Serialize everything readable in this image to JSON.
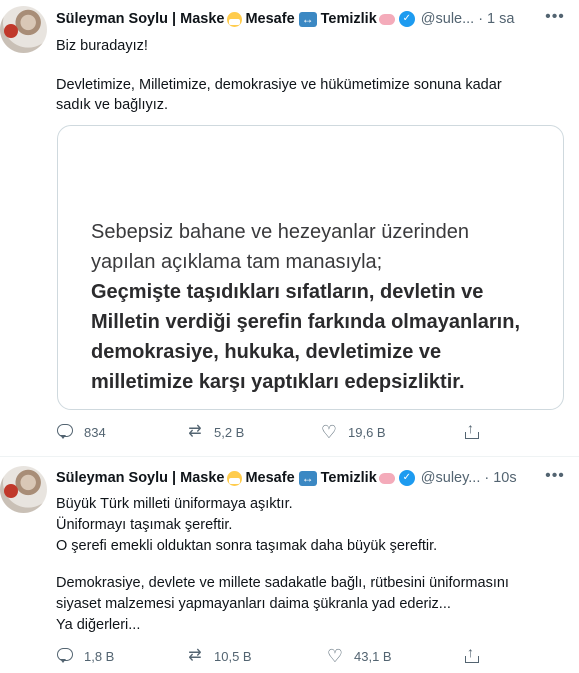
{
  "tweets": [
    {
      "name": "Süleyman Soylu | Maske",
      "mid1": "Mesafe",
      "mid2": "Temizlik",
      "handle": "@sule...",
      "time": "1 sa",
      "text1": "Biz buradayız!",
      "text2": "Devletimize, Milletimize, demokrasiye ve hükümetimize sonuna kadar sadık ve bağlıyız.",
      "card": {
        "line1": "Sebepsiz bahane ve hezeyanlar üzerinden",
        "line2": "yapılan açıklama tam manasıyla;",
        "bold1": "Geçmişte taşıdıkları sıfatların, devletin ve",
        "bold2": "Milletin verdiği şerefin farkında olmayanların,",
        "bold3": "demokrasiye, hukuka, devletimize ve",
        "bold4": "milletimize karşı yaptıkları edepsizliktir."
      },
      "replies": "834",
      "retweets": "5,2 B",
      "likes": "19,6 B"
    },
    {
      "name": "Süleyman Soylu | Maske",
      "mid1": "Mesafe",
      "mid2": "Temizlik",
      "handle": "@suley...",
      "time": "10s",
      "lines": [
        "Büyük Türk milleti üniformaya aşıktır.",
        "Üniformayı taşımak şereftir.",
        "O şerefi emekli olduktan sonra taşımak daha büyük şereftir.",
        "Demokrasiye, devlete ve millete sadakatle bağlı, rütbesini üniformasını",
        "siyaset malzemesi yapmayanları daima şükranla yad ederiz...",
        "Ya diğerleri..."
      ],
      "replies": "1,8 B",
      "retweets": "10,5 B",
      "likes": "43,1 B"
    }
  ]
}
